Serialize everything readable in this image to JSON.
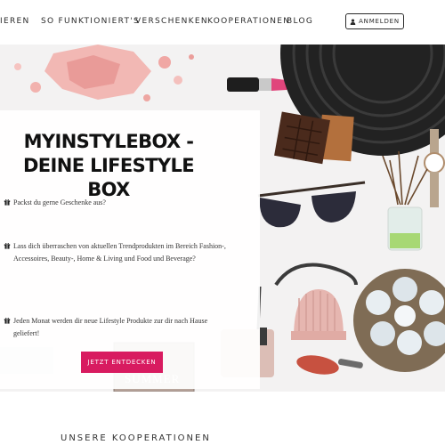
{
  "nav": {
    "items": [
      "IEREN",
      "SO FUNKTIONIERT'S",
      "VERSCHENKEN",
      "KOOPERATIONEN",
      "BLOG"
    ],
    "login_label": "ANMELDEN"
  },
  "hero": {
    "title": "MYINSTYLEBOX - DEINE LIFESTYLE BOX",
    "bullets": [
      "Packst du gerne Geschenke aus?",
      "Lass dich überraschen von aktuellen Trendprodukten im Bereich Fashion-, Accessoires, Beauty-, Home & Living und Food und Beverage?",
      "Jeden Monat werden dir neue Lifestyle Produkte zur dir nach Hause geliefert!"
    ],
    "cta_label": "JETZT ENTDECKEN",
    "magazine_text": "SUMMER"
  },
  "sections": {
    "cooperations_title": "UNSERE KOOPERATIONEN"
  },
  "colors": {
    "accent": "#d81b60",
    "text": "#2b2b2b"
  },
  "icons": {
    "login": "user-icon",
    "bullet": "gift-icon"
  }
}
